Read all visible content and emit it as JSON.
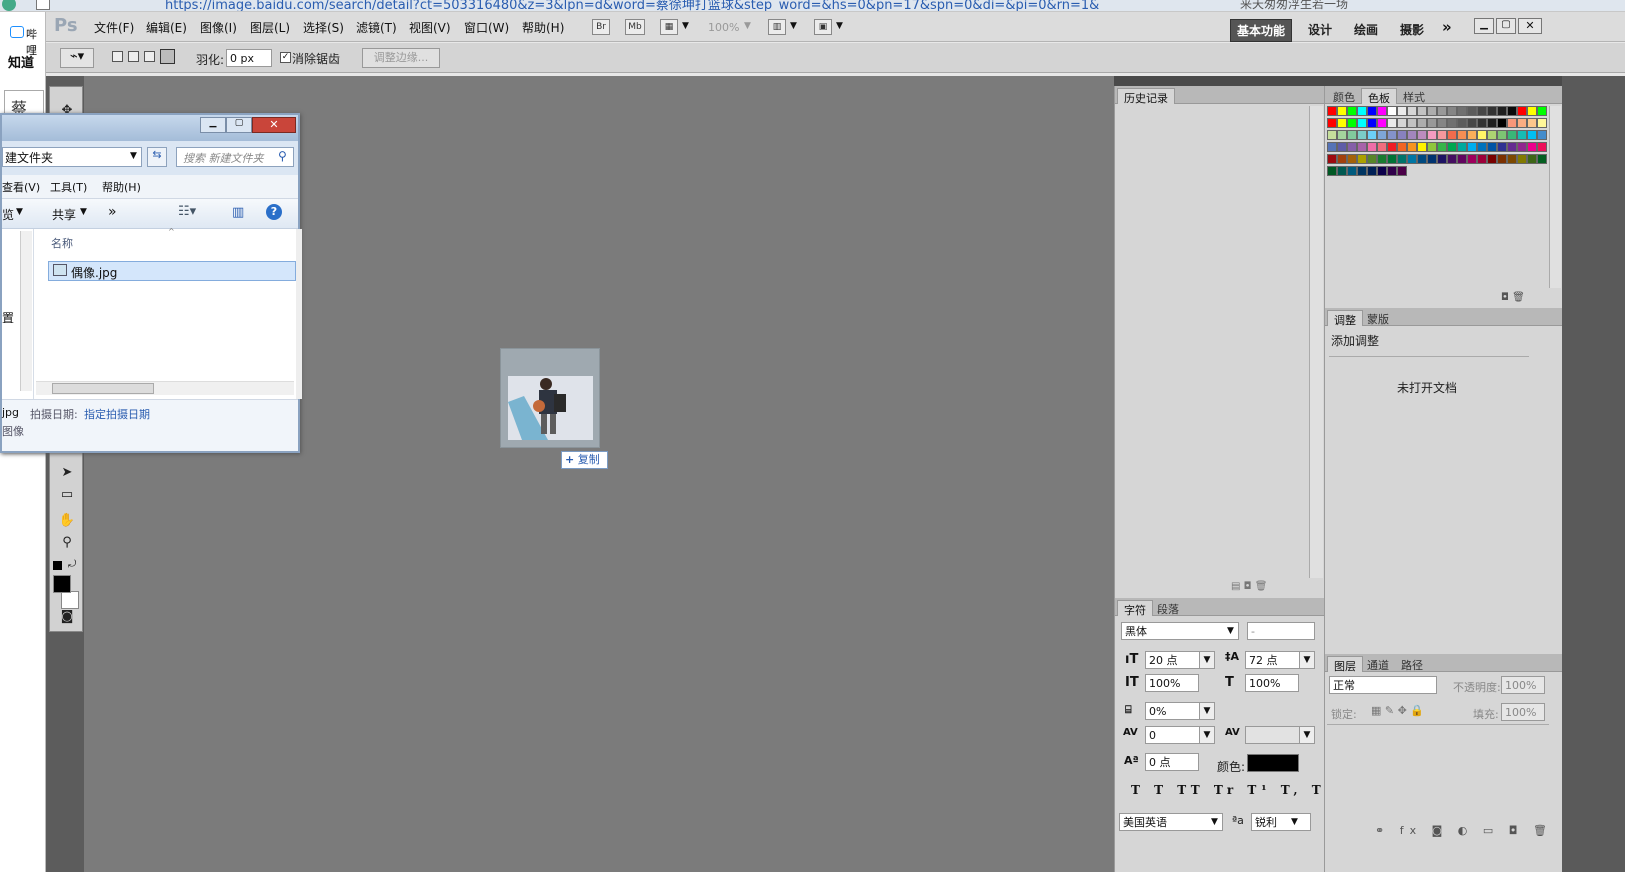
{
  "browser": {
    "url": "https://image.baidu.com/search/detail?ct=503316480&z=3&lpn=d&word=蔡徐坤打篮球&step_word=&hs=0&pn=17&spn=0&di=&pi=0&rn=1&",
    "tab_title": "来天匆匆浮生若一场",
    "left_item": "哔哩",
    "left_link": "知道",
    "left_search": "蔡徐"
  },
  "app": {
    "logo": "Ps"
  },
  "menus": [
    "文件(F)",
    "编辑(E)",
    "图像(I)",
    "图层(L)",
    "选择(S)",
    "滤镜(T)",
    "视图(V)",
    "窗口(W)",
    "帮助(H)"
  ],
  "appbar": {
    "br": "Br",
    "mb": "Mb",
    "zoom": "100%"
  },
  "workspaces": [
    "基本功能",
    "设计",
    "绘画",
    "摄影"
  ],
  "options": {
    "feather_label": "羽化:",
    "feather_value": "0 px",
    "antialias_label": "消除锯齿",
    "refine_edge": "调整边缘..."
  },
  "drag": {
    "copy_label": "复制"
  },
  "history_panel": {
    "tab": "历史记录"
  },
  "color_panel": {
    "tabs": [
      "颜色",
      "色板",
      "样式"
    ]
  },
  "adjust_panel": {
    "tabs": [
      "调整",
      "蒙版"
    ],
    "title": "添加调整",
    "message": "未打开文档"
  },
  "char_panel": {
    "tabs": [
      "字符",
      "段落"
    ],
    "font": "黑体",
    "style": "-",
    "size": "20 点",
    "leading": "72 点",
    "vscale": "100%",
    "hscale": "100%",
    "tsume": "0%",
    "kerning": "0",
    "tracking": "",
    "baseline": "0 点",
    "color_label": "颜色:",
    "language": "美国英语",
    "aa_label": "ªa",
    "aa": "锐利"
  },
  "layers_panel": {
    "tabs": [
      "图层",
      "通道",
      "路径"
    ],
    "blend": "正常",
    "opacity_label": "不透明度:",
    "opacity": "100%",
    "lock_label": "锁定:",
    "fill_label": "填充:",
    "fill": "100%"
  },
  "explorer": {
    "path": "建文件夹",
    "search": "搜索 新建文件夹",
    "menu": [
      "查看(V)",
      "工具(T)",
      "帮助(H)"
    ],
    "toolbar": [
      "览",
      "共享",
      "»"
    ],
    "col_name": "名称",
    "file": "偶像.jpg",
    "side_label": "置",
    "status_name": "jpg",
    "status_date_label": "拍摄日期:",
    "status_date": "指定拍摄日期",
    "status_type": "图像"
  },
  "colors": {
    "accent": "#3a6ea5",
    "panel": "#d6d6d6",
    "canvas": "#7b7b7b"
  }
}
